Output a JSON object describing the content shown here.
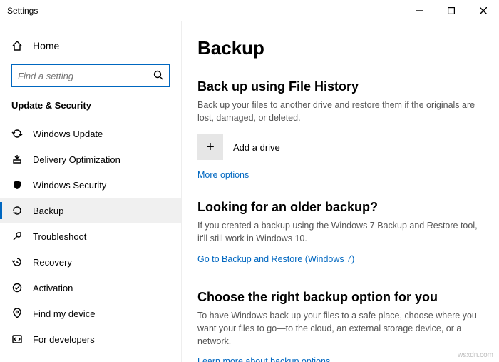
{
  "window": {
    "title": "Settings"
  },
  "sidebar": {
    "home": "Home",
    "search_placeholder": "Find a setting",
    "section": "Update & Security",
    "items": [
      {
        "label": "Windows Update"
      },
      {
        "label": "Delivery Optimization"
      },
      {
        "label": "Windows Security"
      },
      {
        "label": "Backup"
      },
      {
        "label": "Troubleshoot"
      },
      {
        "label": "Recovery"
      },
      {
        "label": "Activation"
      },
      {
        "label": "Find my device"
      },
      {
        "label": "For developers"
      }
    ]
  },
  "main": {
    "title": "Backup",
    "s1": {
      "heading": "Back up using File History",
      "body": "Back up your files to another drive and restore them if the originals are lost, damaged, or deleted.",
      "add": "Add a drive",
      "link": "More options"
    },
    "s2": {
      "heading": "Looking for an older backup?",
      "body": "If you created a backup using the Windows 7 Backup and Restore tool, it'll still work in Windows 10.",
      "link": "Go to Backup and Restore (Windows 7)"
    },
    "s3": {
      "heading": "Choose the right backup option for you",
      "body": "To have Windows back up your files to a safe place, choose where you want your files to go—to the cloud, an external storage device, or a network.",
      "link": "Learn more about backup options"
    }
  },
  "watermark": "wsxdn.com"
}
